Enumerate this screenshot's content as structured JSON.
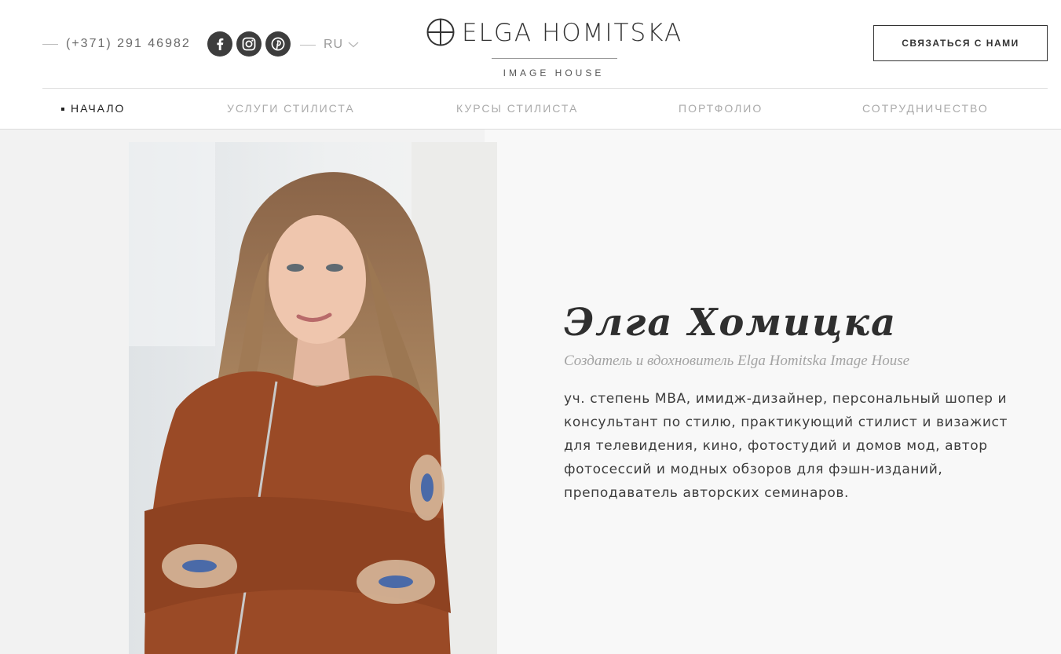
{
  "header": {
    "phone": "(+371) 291 46982",
    "language": "RU",
    "logo": {
      "name": "ELGA HOMITSKA",
      "subtitle": "IMAGE HOUSE"
    },
    "contact_button": "связаться с нами",
    "socials": [
      {
        "name": "facebook",
        "icon": "facebook-icon"
      },
      {
        "name": "instagram",
        "icon": "instagram-icon"
      },
      {
        "name": "pinterest",
        "icon": "pinterest-icon"
      }
    ]
  },
  "nav": {
    "items": [
      {
        "label": "НАЧАЛО",
        "active": true
      },
      {
        "label": "УСЛУГИ СТИЛИСТА",
        "active": false
      },
      {
        "label": "КУРСЫ СТИЛИСТА",
        "active": false
      },
      {
        "label": "ПОРТФОЛИО",
        "active": false
      },
      {
        "label": "СОТРУДНИЧЕСТВО",
        "active": false
      }
    ]
  },
  "hero": {
    "name": "Элга Хомицка",
    "role": "Создатель и вдохновитель Elga Homitska Image House",
    "description": "уч. степень MBA, имидж-дизайнер, персональный шопер и консультант по стилю, практикующий стилист и визажист для телевидения, кино, фотостудий и домов мод, автор фотосессий и модных обзоров для фэшн-изданий, преподаватель авторских семинаров."
  },
  "colors": {
    "text": "#333333",
    "social_bg": "#3d3d3d",
    "nav_inactive": "#aaaaaa",
    "hero_bg": "#f2f2f2",
    "jacket": "#9a4a26"
  }
}
